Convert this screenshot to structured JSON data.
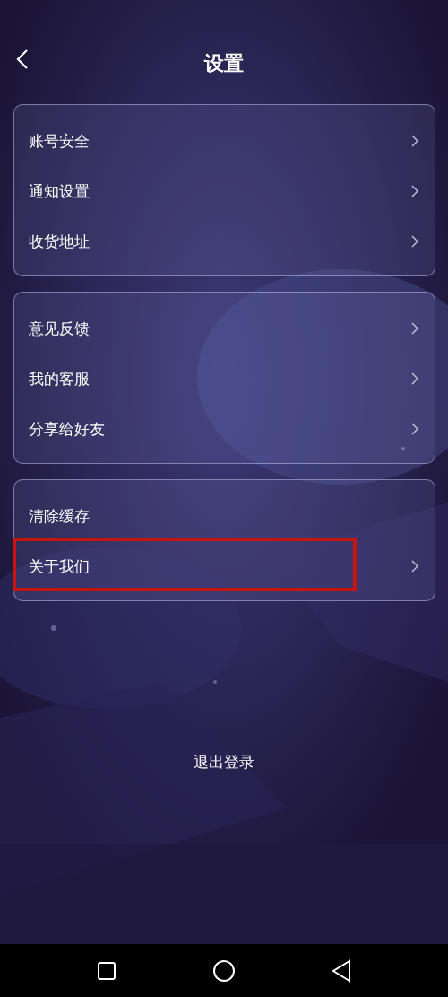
{
  "header": {
    "title": "设置"
  },
  "groups": [
    {
      "items": [
        {
          "label": "账号安全",
          "arrow": true,
          "highlighted": false
        },
        {
          "label": "通知设置",
          "arrow": true,
          "highlighted": false
        },
        {
          "label": "收货地址",
          "arrow": true,
          "highlighted": false
        }
      ]
    },
    {
      "items": [
        {
          "label": "意见反馈",
          "arrow": true,
          "highlighted": false
        },
        {
          "label": "我的客服",
          "arrow": true,
          "highlighted": false
        },
        {
          "label": "分享给好友",
          "arrow": true,
          "highlighted": false
        }
      ]
    },
    {
      "items": [
        {
          "label": "清除缓存",
          "arrow": false,
          "highlighted": false
        },
        {
          "label": "关于我们",
          "arrow": true,
          "highlighted": true
        }
      ]
    }
  ],
  "logout": "退出登录",
  "nav_bar": {
    "buttons": [
      {
        "kind": "square"
      },
      {
        "kind": "circle"
      },
      {
        "kind": "triangle"
      }
    ]
  }
}
